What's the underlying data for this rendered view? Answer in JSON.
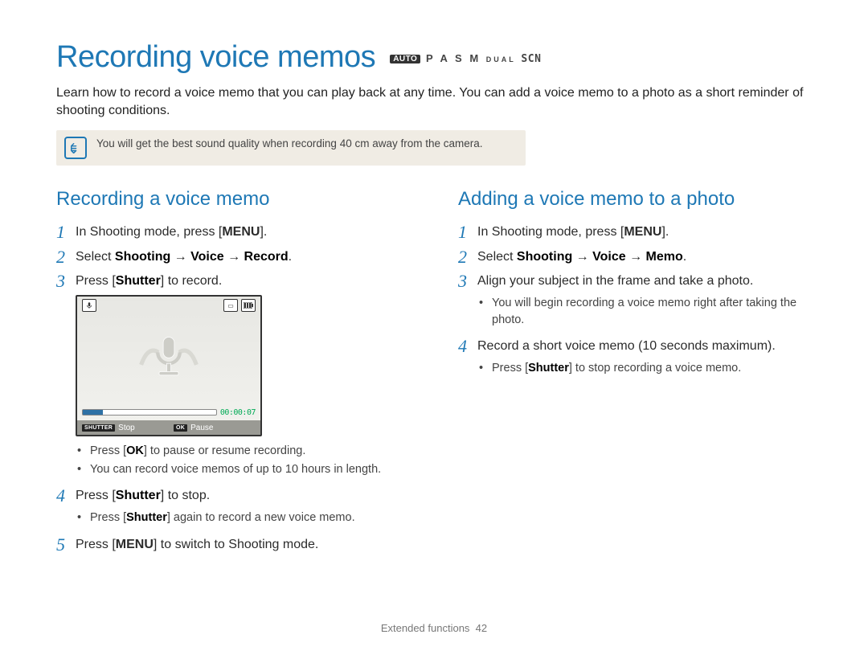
{
  "header": {
    "title_left": "Recording",
    "title_right": "voice memos",
    "modes": {
      "auto": "AUTO",
      "letters": "P A S M",
      "dual": "DUAL",
      "scn": "SCN"
    }
  },
  "intro": "Learn how to record a voice memo that you can play back at any time. You can add a voice memo to a photo as a short reminder of shooting conditions.",
  "tip": "You will get the best sound quality when recording 40 cm away from the camera.",
  "left": {
    "heading": "Recording a voice memo",
    "s1": {
      "pre": "In Shooting mode, press [",
      "btn": "MENU",
      "post": "]."
    },
    "s2": {
      "pre": "Select ",
      "b1": "Shooting",
      "arrow": " → ",
      "b2": "Voice",
      "b3": "Record",
      "post": "."
    },
    "s3": {
      "pre": "Press [",
      "btn": "Shutter",
      "post": "] to record."
    },
    "lcd": {
      "time": "00:00:07",
      "shutter_label": "SHUTTER",
      "shutter_action": "Stop",
      "ok_label": "OK",
      "ok_action": "Pause"
    },
    "s3_sub1_pre": "Press [",
    "s3_sub1_btn": "OK",
    "s3_sub1_post": "] to pause or resume recording.",
    "s3_sub2": "You can record voice memos of up to 10 hours in length.",
    "s4": {
      "pre": "Press [",
      "btn": "Shutter",
      "post": "] to stop."
    },
    "s4_sub_pre": "Press [",
    "s4_sub_btn": "Shutter",
    "s4_sub_post": "] again to record a new voice memo.",
    "s5": {
      "pre": "Press [",
      "btn": "MENU",
      "post": "] to switch to Shooting mode."
    }
  },
  "right": {
    "heading": "Adding a voice memo to a photo",
    "s1": {
      "pre": "In Shooting mode, press [",
      "btn": "MENU",
      "post": "]."
    },
    "s2": {
      "pre": "Select ",
      "b1": "Shooting",
      "arrow": " → ",
      "b2": "Voice",
      "b3": "Memo",
      "post": "."
    },
    "s3": "Align your subject in the frame and take a photo.",
    "s3_sub": "You will begin recording a voice memo right after taking the photo.",
    "s4": "Record a short voice memo (10 seconds maximum).",
    "s4_sub_pre": "Press [",
    "s4_sub_btn": "Shutter",
    "s4_sub_post": "] to stop recording a voice memo."
  },
  "footer": {
    "section": "Extended functions",
    "page": "42"
  }
}
